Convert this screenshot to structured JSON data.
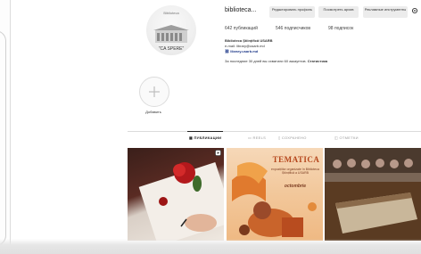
{
  "profile": {
    "avatar_top_text": "Biblioteca",
    "avatar_bottom_text": "\"CA SPERE\"",
    "username": "biblioteca...",
    "buttons": {
      "edit": "Редактировать профиль",
      "archive": "Посмотреть архив",
      "tools": "Рекламные инструменты"
    },
    "stats": {
      "posts": "642 публикаций",
      "followers": "546 подписчиков",
      "following": "98 подписок"
    },
    "bio": {
      "name": "Biblioteca Ştiinţifică USARB",
      "email": "e-mail: library@usarb.md",
      "link": "library.usarb.md",
      "stats_text": "За последние 30 дней вы охватили 60 аккаунтов.",
      "stats_link": "Статистика"
    }
  },
  "highlights": [
    {
      "label": "Добавить"
    }
  ],
  "tabs": [
    {
      "label": "ПУБЛИКАЦИИ",
      "active": true
    },
    {
      "label": "REELS",
      "active": false
    },
    {
      "label": "СОХРАНЕНО",
      "active": false
    },
    {
      "label": "ОТМЕТКИ",
      "active": false
    }
  ],
  "posts": [
    {
      "kind": "image",
      "icon": "reel-icon"
    },
    {
      "kind": "poster",
      "title": "TEMATICA",
      "subtitle": "expozițiilor organizate în Biblioteca Științifică a USARB",
      "month": "octombrie"
    },
    {
      "kind": "image"
    }
  ],
  "colors": {
    "accent_link": "#1f3a8a",
    "poster_title": "#b5451b"
  }
}
